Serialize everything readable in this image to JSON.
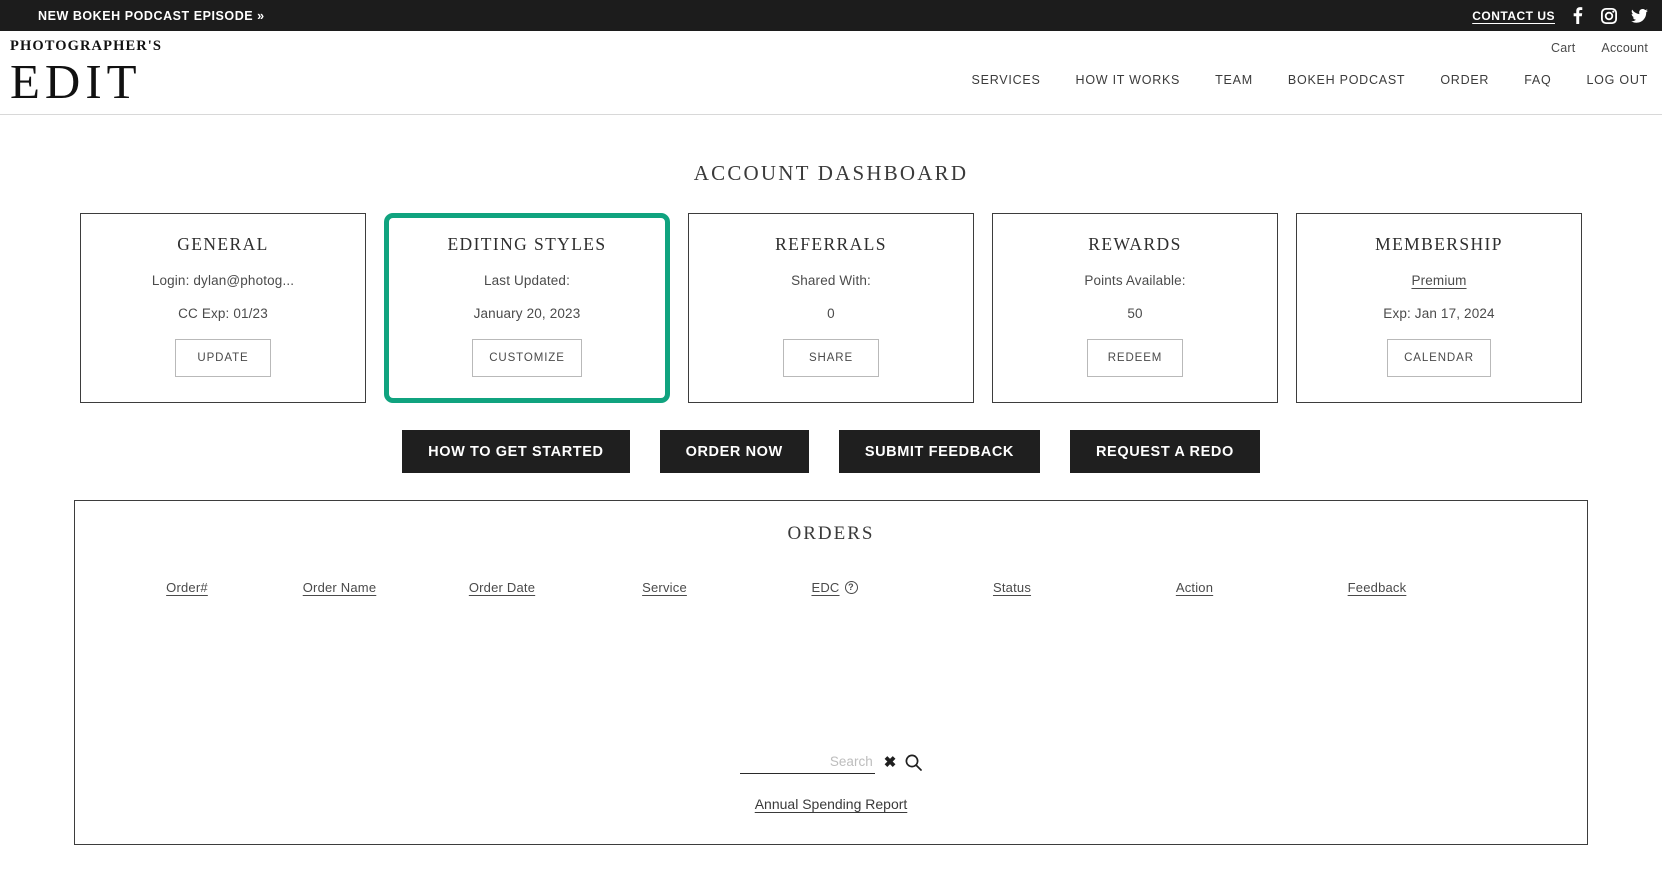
{
  "announcement": {
    "text": "NEW BOKEH PODCAST EPISODE »",
    "contact_label": "CONTACT US",
    "social": [
      {
        "name": "facebook-icon",
        "label": "Facebook"
      },
      {
        "name": "instagram-icon",
        "label": "Instagram"
      },
      {
        "name": "twitter-icon",
        "label": "Twitter"
      }
    ]
  },
  "header": {
    "logo_top": "PHOTOGRAPHER'S",
    "logo_main": "EDIT",
    "utility_nav": [
      "Cart",
      "Account"
    ],
    "main_nav": [
      "SERVICES",
      "HOW IT WORKS",
      "TEAM",
      "BOKEH PODCAST",
      "ORDER",
      "FAQ",
      "LOG OUT"
    ]
  },
  "page": {
    "title": "ACCOUNT DASHBOARD"
  },
  "cards": [
    {
      "title": "GENERAL",
      "line1": "Login: dylan@photog...",
      "line2": "CC Exp: 01/23",
      "button": "UPDATE",
      "highlighted": false,
      "line2_is_link": false
    },
    {
      "title": "EDITING STYLES",
      "line1": "Last Updated:",
      "line2": "January 20, 2023",
      "button": "CUSTOMIZE",
      "highlighted": true,
      "line2_is_link": false
    },
    {
      "title": "REFERRALS",
      "line1": "Shared With:",
      "line2": "0",
      "button": "SHARE",
      "highlighted": false,
      "line2_is_link": false
    },
    {
      "title": "REWARDS",
      "line1": "Points Available:",
      "line2": "50",
      "button": "REDEEM",
      "highlighted": false,
      "line2_is_link": false
    },
    {
      "title": "MEMBERSHIP",
      "line1": "Premium",
      "line2": "Exp: Jan 17, 2024",
      "button": "CALENDAR",
      "highlighted": false,
      "line1_is_link": true
    }
  ],
  "actions": [
    "HOW TO GET STARTED",
    "ORDER NOW",
    "SUBMIT FEEDBACK",
    "REQUEST A REDO"
  ],
  "orders": {
    "title": "ORDERS",
    "columns": [
      {
        "label": "Order#",
        "help": false
      },
      {
        "label": "Order Name",
        "help": false
      },
      {
        "label": "Order Date",
        "help": false
      },
      {
        "label": "Service",
        "help": false
      },
      {
        "label": "EDC",
        "help": true
      },
      {
        "label": "Status",
        "help": false
      },
      {
        "label": "Action",
        "help": false
      },
      {
        "label": "Feedback",
        "help": false
      }
    ],
    "rows": [],
    "search_placeholder": "Search",
    "search_value": "",
    "clear_icon": "✖",
    "report_link": "Annual Spending Report"
  },
  "colors": {
    "accent_highlight": "#10a37f",
    "dark_bar": "#1c1c1c",
    "button_dark": "#1f1f1f"
  }
}
